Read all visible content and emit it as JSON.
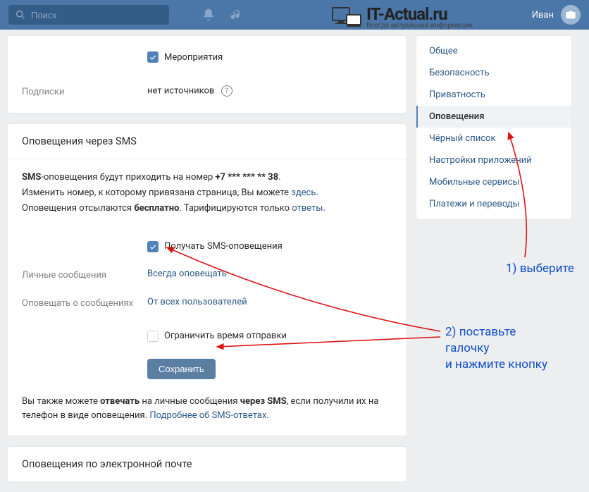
{
  "topbar": {
    "search_placeholder": "Поиск",
    "user_name": "Иван"
  },
  "watermark": {
    "title": "IT-Actual.ru",
    "subtitle": "Всегда актуальная информация"
  },
  "section_events": {
    "checkbox_label": "Мероприятия",
    "subscriptions_label": "Подписки",
    "subscriptions_value": "нет источников"
  },
  "sms": {
    "title": "Оповещения через SMS",
    "line1_a": "SMS",
    "line1_b": "-оповещения будут приходить на номер ",
    "line1_phone": "+7 *** *** ** 38",
    "line2_a": "Изменить номер, к которому привязана страница, Вы можете ",
    "line2_link": "здесь",
    "line3_a": "Оповещения отсылаются ",
    "line3_b": "бесплатно",
    "line3_c": ". Тарифицируются только ",
    "line3_link": "ответы",
    "receive_label": "Получать SMS-оповещения",
    "personal_label": "Личные сообщения",
    "personal_value": "Всегда оповещать",
    "notify_label": "Оповещать о сообщениях",
    "notify_value": "От всех пользователей",
    "limit_label": "Ограничить время отправки",
    "save_button": "Сохранить",
    "footer_a": "Вы также можете ",
    "footer_b": "отвечать",
    "footer_c": " на личные сообщения ",
    "footer_d": "через SMS",
    "footer_e": ", если получили их на телефон в виде оповещения. ",
    "footer_link": "Подробнее об SMS-ответах"
  },
  "email": {
    "title": "Оповещения по электронной почте"
  },
  "sidebar": {
    "items": [
      "Общее",
      "Безопасность",
      "Приватность",
      "Оповещения",
      "Чёрный список",
      "Настройки приложений",
      "Мобильные сервисы",
      "Платежи и переводы"
    ],
    "active_index": 3
  },
  "annotations": {
    "a1": "1) выберите",
    "a2": "2) поставьте\nгалочку\nи нажмите кнопку"
  }
}
